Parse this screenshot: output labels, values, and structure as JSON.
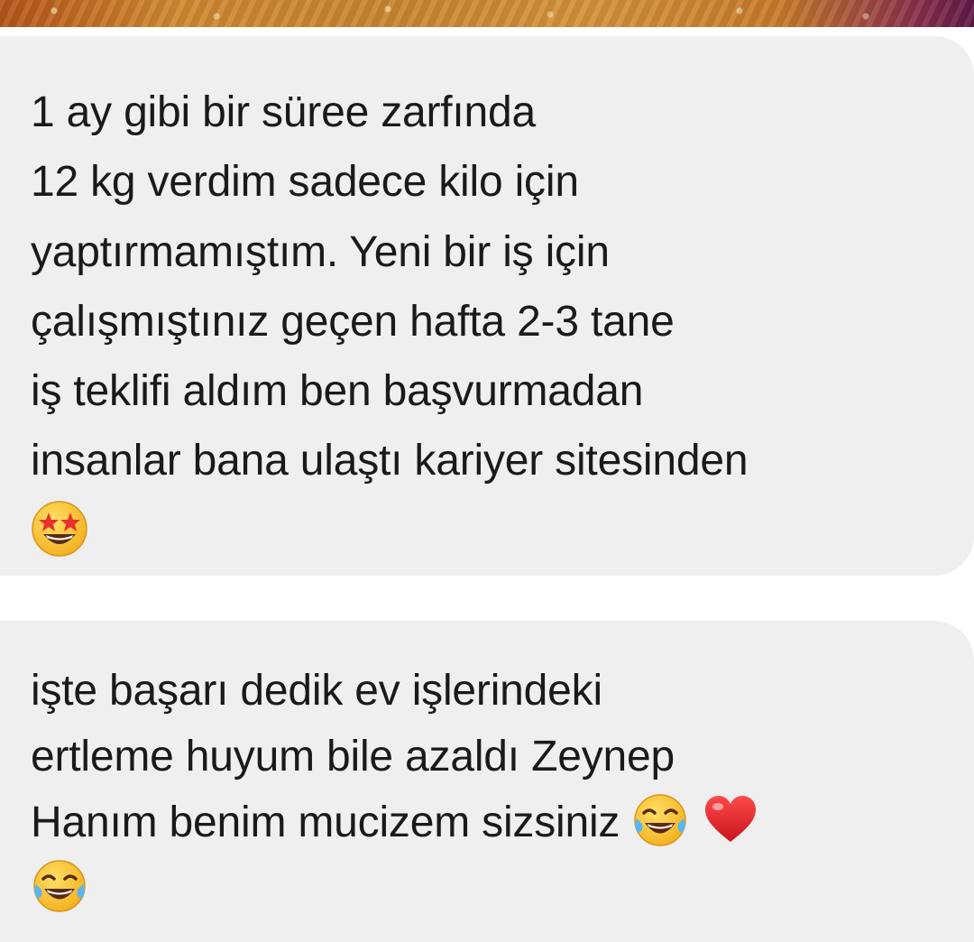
{
  "messages": [
    {
      "lines": [
        "1 ay gibi bir süree zarfında",
        "12 kg verdim sadece kilo için",
        "yaptırmamıştım. Yeni bir iş için",
        "çalışmıştınız geçen hafta 2-3 tane",
        "iş teklifi aldım  ben başvurmadan",
        "insanlar bana ulaştı kariyer sitesinden"
      ],
      "emoji": "star-struck-emoji"
    },
    {
      "lines": [
        "işte başarı dedik ev işlerindeki",
        "ertleme huyum bile azaldı Zeynep",
        "Hanım benim mucizem sizsiniz"
      ],
      "emoji_inline": [
        "tears-of-joy-emoji",
        "red-heart-emoji"
      ],
      "emoji_last": "tears-of-joy-emoji"
    }
  ],
  "colors": {
    "bubble": "#efefef",
    "text": "#1a1a1a",
    "banner_start": "#b5541a",
    "banner_end": "#5e1a45"
  }
}
